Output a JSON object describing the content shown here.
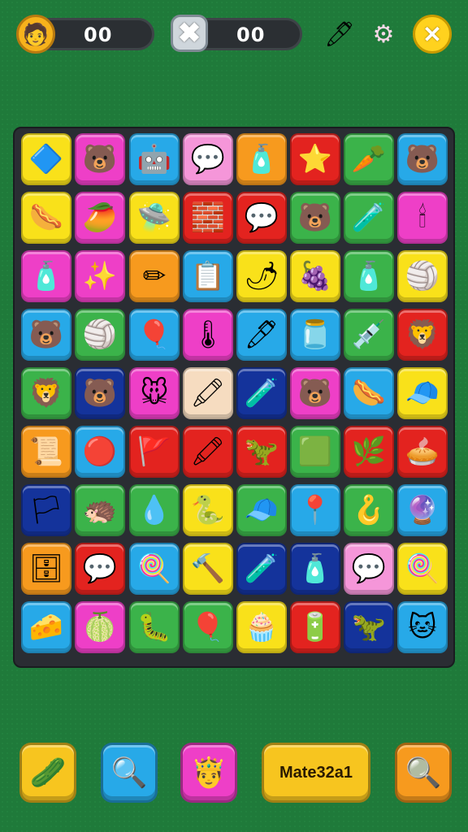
{
  "hud": {
    "score_left": "00",
    "score_right": "00",
    "avatar_icon": "🧑",
    "x_icon": "✖",
    "pipette_icon": "🖊",
    "settings_icon": "⚙",
    "close_icon": "✕"
  },
  "colors": {
    "yellow": "#f9e11a",
    "magenta": "#ee3fc7",
    "cyan": "#27a9e8",
    "pink": "#f596d9",
    "orange": "#f79a1e",
    "red": "#e3231f",
    "green": "#3bb34a",
    "navy": "#14339b",
    "peach": "#f6dcc0",
    "lime": "#c6e23a"
  },
  "board": {
    "rows": [
      [
        [
          "yellow",
          "🔷"
        ],
        [
          "magenta",
          "🐻"
        ],
        [
          "cyan",
          "🤖"
        ],
        [
          "pink",
          "💬"
        ],
        [
          "orange",
          "🧴"
        ],
        [
          "red",
          "⭐"
        ],
        [
          "green",
          "🥕"
        ],
        [
          "cyan",
          "🐻"
        ]
      ],
      [
        [
          "yellow",
          "🌭"
        ],
        [
          "magenta",
          "🥭"
        ],
        [
          "yellow",
          "🛸"
        ],
        [
          "red",
          "🧱"
        ],
        [
          "red",
          "💬"
        ],
        [
          "green",
          "🐻"
        ],
        [
          "green",
          "🧪"
        ],
        [
          "magenta",
          "🕯"
        ]
      ],
      [
        [
          "magenta",
          "🧴"
        ],
        [
          "magenta",
          "✨"
        ],
        [
          "orange",
          "✏"
        ],
        [
          "cyan",
          "📋"
        ],
        [
          "yellow",
          "🌶"
        ],
        [
          "yellow",
          "🍇"
        ],
        [
          "green",
          "🧴"
        ],
        [
          "yellow",
          "🏐"
        ]
      ],
      [
        [
          "cyan",
          "🐻"
        ],
        [
          "green",
          "🏐"
        ],
        [
          "cyan",
          "🎈"
        ],
        [
          "magenta",
          "🌡"
        ],
        [
          "cyan",
          "🖊"
        ],
        [
          "cyan",
          "🫙"
        ],
        [
          "green",
          "💉"
        ],
        [
          "red",
          "🦁"
        ]
      ],
      [
        [
          "green",
          "🦁"
        ],
        [
          "navy",
          "🐻"
        ],
        [
          "magenta",
          "🐭"
        ],
        [
          "peach",
          "🖍"
        ],
        [
          "navy",
          "🧪"
        ],
        [
          "magenta",
          "🐻"
        ],
        [
          "cyan",
          "🌭"
        ],
        [
          "yellow",
          "🧢"
        ]
      ],
      [
        [
          "orange",
          "📜"
        ],
        [
          "cyan",
          "🔴"
        ],
        [
          "red",
          "🚩"
        ],
        [
          "red",
          "🖍"
        ],
        [
          "red",
          "🦖"
        ],
        [
          "green",
          "🟩"
        ],
        [
          "red",
          "🌿"
        ],
        [
          "red",
          "🥧"
        ]
      ],
      [
        [
          "navy",
          "🏳"
        ],
        [
          "green",
          "🦔"
        ],
        [
          "green",
          "💧"
        ],
        [
          "yellow",
          "🐍"
        ],
        [
          "green",
          "🧢"
        ],
        [
          "cyan",
          "📍"
        ],
        [
          "green",
          "🪝"
        ],
        [
          "cyan",
          "🔮"
        ]
      ],
      [
        [
          "orange",
          "🗄"
        ],
        [
          "red",
          "💬"
        ],
        [
          "cyan",
          "🍭"
        ],
        [
          "yellow",
          "🔨"
        ],
        [
          "navy",
          "🧪"
        ],
        [
          "navy",
          "🧴"
        ],
        [
          "pink",
          "💬"
        ],
        [
          "yellow",
          "🍭"
        ]
      ],
      [
        [
          "cyan",
          "🧀"
        ],
        [
          "magenta",
          "🍈"
        ],
        [
          "green",
          "🐛"
        ],
        [
          "green",
          "🎈"
        ],
        [
          "yellow",
          "🧁"
        ],
        [
          "red",
          "🔋"
        ],
        [
          "navy",
          "🦖"
        ],
        [
          "cyan",
          "🐱"
        ]
      ]
    ]
  },
  "bottom": {
    "btn1_icon": "🥒",
    "btn2_icon": "🔍",
    "btn3_icon": "🤴",
    "btn4_label": "Mate32a1",
    "btn5_icon": "🔍"
  }
}
